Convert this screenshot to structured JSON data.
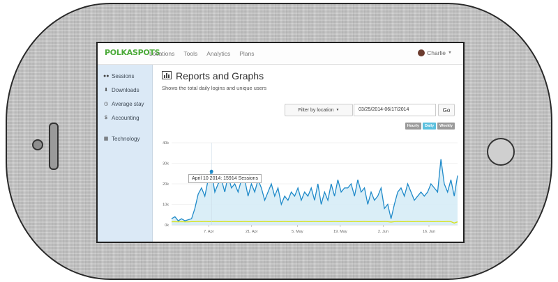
{
  "app": {
    "logo": "POLKASPOTS",
    "user": "Charlie"
  },
  "nav": {
    "items": [
      "Locations",
      "Tools",
      "Analytics",
      "Plans"
    ]
  },
  "sidebar": {
    "items": [
      {
        "icon": "users-icon",
        "label": "Sessions"
      },
      {
        "icon": "download-icon",
        "label": "Downloads"
      },
      {
        "icon": "clock-icon",
        "label": "Average stay"
      },
      {
        "icon": "dollar-icon",
        "label": "Accounting"
      },
      {
        "icon": "calendar-icon",
        "label": "Technology"
      }
    ]
  },
  "page": {
    "title": "Reports and Graphs",
    "subtitle": "Shows the total daily logins and unique users"
  },
  "filters": {
    "location_label": "Filter by location",
    "date_range": "03/25/2014-06/17/2014",
    "go_label": "Go"
  },
  "granularity": {
    "options": [
      "Hourly",
      "Daily",
      "Weekly"
    ],
    "selected": "Daily"
  },
  "colors": {
    "sessions_line": "#1f8ac9",
    "sessions_fill": "#d6ecf6",
    "unique_line": "#d8e21a",
    "daily_pill": "#5bc0de",
    "other_pill": "#9a9a9a"
  },
  "tooltip": {
    "text": "April 10 2014: 15914 Sessions"
  },
  "chart_data": {
    "type": "area",
    "ylim": [
      0,
      40000
    ],
    "y_ticks": [
      "0k",
      "10k",
      "20k",
      "30k",
      "40k"
    ],
    "x_ticks": [
      "7. Apr",
      "21. Apr",
      "5. May",
      "19. May",
      "2. Jun",
      "16. Jun"
    ],
    "series": [
      {
        "values": [
          3000,
          4000,
          2000,
          3000,
          2000,
          2500,
          3000,
          8000,
          15000,
          18000,
          14000,
          22000,
          26000,
          16000,
          20000,
          22000,
          16000,
          24000,
          18000,
          20000,
          16000,
          22000,
          22000,
          14000,
          20000,
          16000,
          22000,
          18000,
          12000,
          16000,
          20000,
          14000,
          18000,
          10000,
          14000,
          12000,
          16000,
          14000,
          18000,
          12000,
          16000,
          14000,
          18000,
          12000,
          20000,
          10000,
          16000,
          12000,
          20000,
          14000,
          22000,
          16000,
          18000,
          18000,
          20000,
          14000,
          22000,
          16000,
          18000,
          10000,
          16000,
          12000,
          14000,
          18000,
          8000,
          10000,
          3000,
          10000,
          16000,
          18000,
          14000,
          20000,
          16000,
          12000,
          14000,
          16000,
          14000,
          16000,
          20000,
          18000,
          16000,
          32000,
          20000,
          16000,
          22000,
          14000,
          24000
        ]
      },
      {
        "values": [
          1500,
          1600,
          1500,
          1600,
          1500,
          1500,
          1600,
          1600,
          1700,
          1600,
          1700,
          1600,
          1600,
          1700,
          1600,
          1600,
          1700,
          1600,
          1600,
          1700,
          1600,
          1600,
          1700,
          1600,
          1600,
          1700,
          1600,
          1600,
          1700,
          1600,
          1600,
          1700,
          1600,
          1600,
          1700,
          1600,
          1600,
          1700,
          1600,
          1600,
          1700,
          1600,
          1600,
          1700,
          1600,
          1600,
          1700,
          1600,
          1600,
          1700,
          1600,
          1600,
          1700,
          1600,
          1600,
          1700,
          1600,
          1600,
          1700,
          1600,
          1600,
          1700,
          1600,
          1600,
          1700,
          1600,
          1400,
          1600,
          1700,
          1600,
          1600,
          1700,
          1600,
          1600,
          1700,
          1600,
          1600,
          1700,
          1600,
          1600,
          1700,
          1600,
          1600,
          1700,
          1600,
          900,
          1500
        ]
      }
    ]
  }
}
